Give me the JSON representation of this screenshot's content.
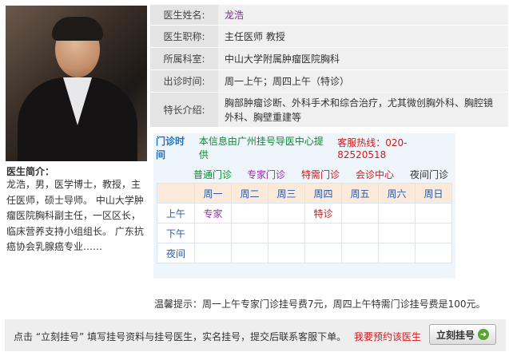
{
  "doctor": {
    "name_label": "医生姓名:",
    "name": "龙浩",
    "title_label": "医生职称:",
    "title": "主任医师 教授",
    "dept_label": "所属科室:",
    "dept": "中山大学附属肿瘤医院胸科",
    "time_label": "出诊时间:",
    "time": "周一上午；周四上午（特诊）",
    "specialty_label": "特长介绍:",
    "specialty": "胸部肿瘤诊断、外科手术和综合治疗，尤其微创胸外科、胸腔镜外科、胸壁重建等"
  },
  "intro": {
    "title": "医生简介：",
    "text": "龙浩，男，医学博士，教授，主任医师，硕士导师。 中山大学肿瘤医院胸科副主任，一区区长，临床营养支持小组组长。 广东抗癌协会乳腺癌专业……"
  },
  "schedule": {
    "header_title": "门诊时间",
    "header_info": "本信息由广州挂号导医中心提供",
    "header_hotline": "客服热线：020-82520518",
    "legend": [
      {
        "label": "普通门诊",
        "color": "#0b8a2e"
      },
      {
        "label": "专家门诊",
        "color": "#9b2fae"
      },
      {
        "label": "特需门诊",
        "color": "#d2191b"
      },
      {
        "label": "会诊中心",
        "color": "#d2191b"
      },
      {
        "label": "夜间门诊",
        "color": "#333333"
      }
    ],
    "days": [
      "周一",
      "周二",
      "周三",
      "周四",
      "周五",
      "周六",
      "周日"
    ],
    "rows": [
      {
        "label": "上午",
        "cells": [
          "专家",
          "",
          "",
          "特诊",
          "",
          "",
          ""
        ]
      },
      {
        "label": "下午",
        "cells": [
          "",
          "",
          "",
          "",
          "",
          "",
          ""
        ]
      },
      {
        "label": "夜间",
        "cells": [
          "",
          "",
          "",
          "",
          "",
          "",
          ""
        ]
      }
    ],
    "cell_colors": {
      "专家": "#9b2fae",
      "特诊": "#d2191b"
    }
  },
  "tip": "温馨提示：周一上午专家门诊挂号费7元，周四上午特需门诊挂号费是100元。",
  "bottom": {
    "message": "点击 “立刻挂号” 填写挂号资料与挂号医生，实名挂号，提交后联系客服下单。",
    "link": "我要预约该医生",
    "button": "立刻挂号",
    "button_icon": "arrow-circle-icon"
  }
}
